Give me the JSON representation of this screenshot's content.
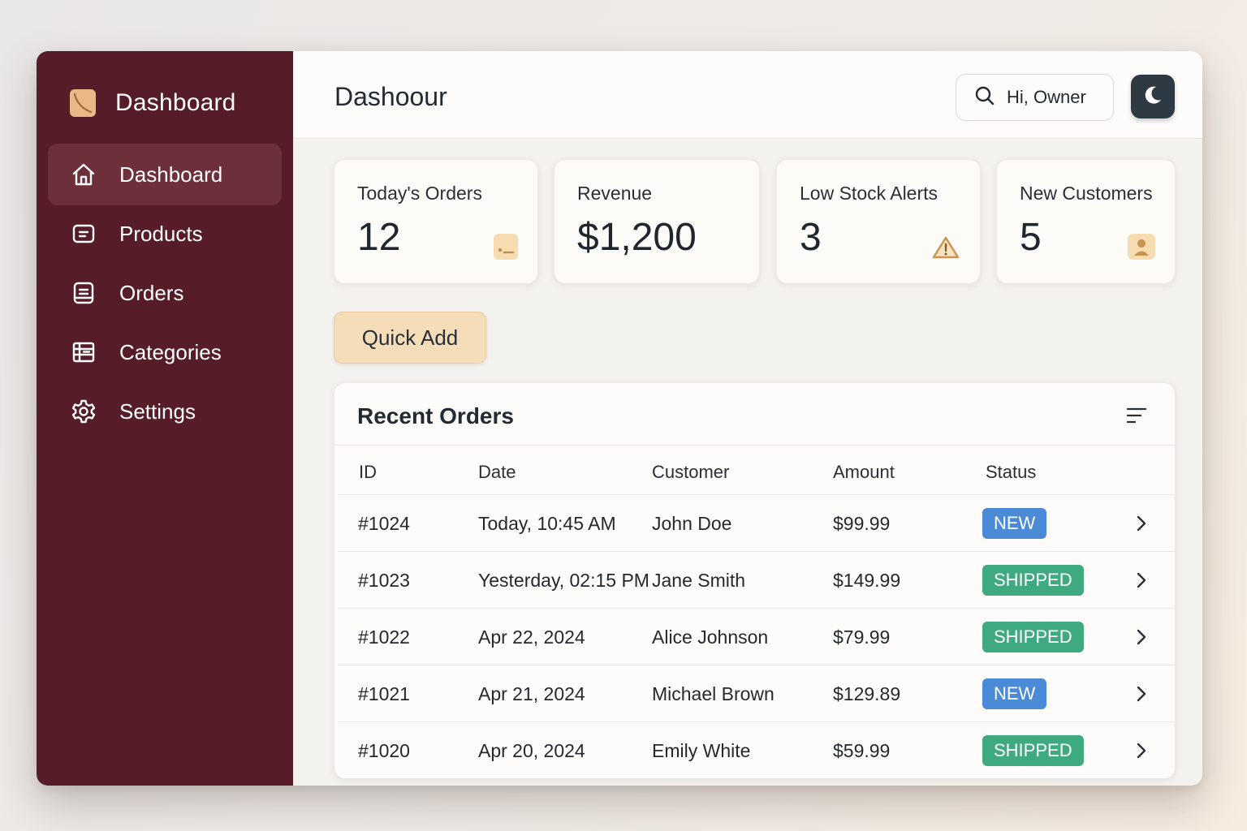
{
  "sidebar": {
    "brand": "Dashboard",
    "items": [
      {
        "label": "Dashboard",
        "icon": "home-icon",
        "active": true
      },
      {
        "label": "Products",
        "icon": "products-icon"
      },
      {
        "label": "Orders",
        "icon": "orders-icon"
      },
      {
        "label": "Categories",
        "icon": "categories-icon"
      },
      {
        "label": "Settings",
        "icon": "gear-icon"
      }
    ]
  },
  "header": {
    "title": "Dashoour",
    "greeting": "Hi, Owner"
  },
  "stats": [
    {
      "label": "Today's Orders",
      "value": "12",
      "icon": "terminal-icon"
    },
    {
      "label": "Revenue",
      "value": "$1,200"
    },
    {
      "label": "Low Stock Alerts",
      "value": "3",
      "icon": "warning-icon"
    },
    {
      "label": "New Customers",
      "value": "5",
      "icon": "user-icon"
    }
  ],
  "quick_add": "Quick Add",
  "orders": {
    "title": "Recent Orders",
    "columns": [
      "ID",
      "Date",
      "Customer",
      "Amount",
      "Status"
    ],
    "rows": [
      {
        "id": "#1024",
        "date": "Today, 10:45 AM",
        "customer": "John Doe",
        "amount": "$99.99",
        "status": "NEW"
      },
      {
        "id": "#1023",
        "date": "Yesterday, 02:15 PM",
        "customer": "Jane Smith",
        "amount": "$149.99",
        "status": "SHIPPED"
      },
      {
        "id": "#1022",
        "date": "Apr 22, 2024",
        "customer": "Alice Johnson",
        "amount": "$79.99",
        "status": "SHIPPED"
      },
      {
        "id": "#1021",
        "date": "Apr 21, 2024",
        "customer": "Michael Brown",
        "amount": "$129.89",
        "status": "NEW"
      },
      {
        "id": "#1020",
        "date": "Apr 20, 2024",
        "customer": "Emily White",
        "amount": "$59.99",
        "status": "SHIPPED"
      }
    ]
  },
  "colors": {
    "sidebar": "#561c27",
    "sidebar_active": "#6d303a",
    "accent": "#f5ddb9",
    "badge_new": "#4a8ad6",
    "badge_shipped": "#3fa97f"
  }
}
